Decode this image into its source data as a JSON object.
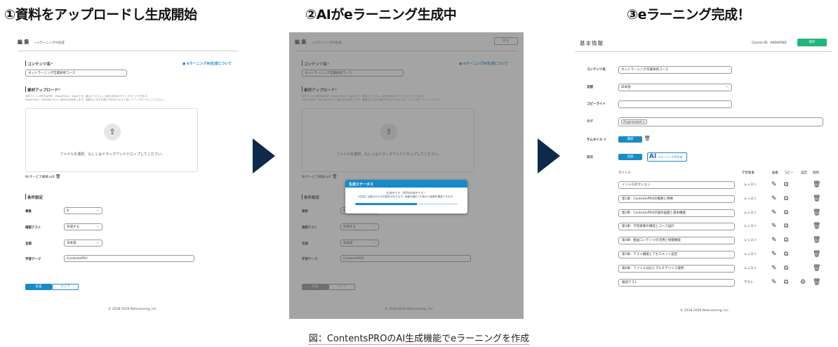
{
  "steps": {
    "step1": "①資料をアップロードし生成開始",
    "step2": "②AIがeラーニング生成中",
    "step3": "③eラーニング完成！"
  },
  "caption": "図：ContentsPROのAI生成機能でeラーニングを作成",
  "colors": {
    "accent": "#1a8ac7",
    "green": "#21b57e",
    "arrow": "#0d2a4a"
  },
  "panel1": {
    "header": "編 集",
    "breadcrumb": "»  eラーニングAI生成",
    "content_name_label": "コンテンツ名",
    "required": "*",
    "about_link": "eラーニングAI生成について",
    "content_name_value": "ネットラーニング営業研修コース",
    "upload_label": "素材アップロード",
    "upload_help_1": "対応ファイル形式はPDF・PowerPoint・Wordです。最大5ファイル、合計50MBまでアップロードできます。",
    "upload_help_2": "PowerPoint・Wordはテキスト部分のみ対応します。画像など文字の無いPDFはテキスト化してアップロードしてください。",
    "upload_prompt": "ファイルを選択、もしくはドラッグアンドドロップしてください。",
    "file_name": "NLサービス概要.pdf",
    "conditions_label": "条件設定",
    "chapters_label": "章数",
    "chapters_value": "8",
    "test_label": "確認テスト",
    "test_value": "作成する",
    "language_label": "言語",
    "language_value": "日本語",
    "theme_label": "学習テーマ",
    "theme_value": "ContentsPRO",
    "generate_btn": "生成",
    "clear_btn": "クリア",
    "footer": "© 2018-2026 NetLearning, Inc."
  },
  "panel2": {
    "back_btn": "戻る",
    "modal_title": "生成ステータス",
    "modal_line1": "生成中です（60%作成中です）",
    "modal_line2": "※生成には数分かかる可能性があります。画面を離れても後から結果を確認できます。",
    "progress": 0.6
  },
  "panel3": {
    "header": "基本情報",
    "course_id": "Course ID：A000058Z",
    "save_btn": "保存",
    "content_name_label": "コンテンツ名",
    "content_name_value": "ネットラーニング営業研修コース",
    "language_label": "言語",
    "language_value": "日本語",
    "copyright_label": "コピーライト",
    "tag_label": "タグ",
    "tag_value": "AI-generated ×",
    "thumb_label": "サムネイル ⑦",
    "select_btn": "選択",
    "toc_label": "目次",
    "add_btn": "追加",
    "ai_btn": "eラーニングAI生成",
    "ai_logo": "AI",
    "col_title": "タイトル",
    "col_type": "学習要素",
    "col_edit": "編集",
    "col_copy": "コピー",
    "col_settings": "設定",
    "col_delete": "削除",
    "rows": [
      {
        "title": "イントロダクション",
        "type": "レッスン",
        "settings": false
      },
      {
        "title": "第1章：ContentsPROの概要と特徴",
        "type": "レッスン",
        "settings": false
      },
      {
        "title": "第2章：ContentsPROの操作画面と基本機能",
        "type": "レッスン",
        "settings": false
      },
      {
        "title": "第3章：学習要素の構成とコース設計",
        "type": "レッスン",
        "settings": false
      },
      {
        "title": "第4章：動画コンテンツの活用と制御機能",
        "type": "レッスン",
        "settings": false
      },
      {
        "title": "第5章：テスト機能とアセスメント設定",
        "type": "レッスン",
        "settings": false
      },
      {
        "title": "第6章：ファイル対応とマルチデバイス運用",
        "type": "レッスン",
        "settings": false
      },
      {
        "title": "確認テスト",
        "type": "テスト",
        "settings": true
      }
    ],
    "footer": "© 2018-2026 NetLearning, Inc."
  }
}
